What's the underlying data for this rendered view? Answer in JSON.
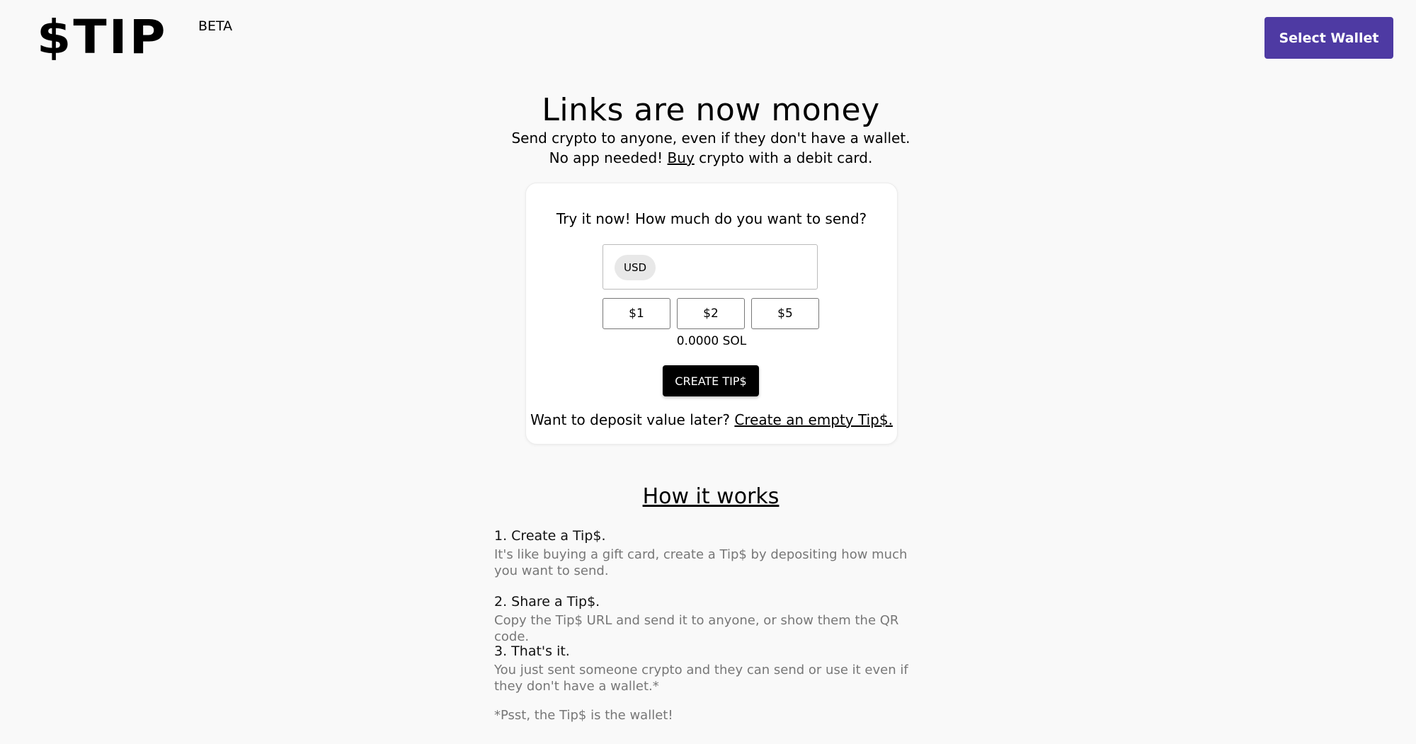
{
  "header": {
    "logo_text": "$TIP",
    "beta_label": "BETA",
    "wallet_button": "Select Wallet"
  },
  "hero": {
    "title": "Links are now money",
    "subtitle_line1": "Send crypto to anyone, even if they don't have a wallet.",
    "subtitle_line2_prefix": "No app needed! ",
    "subtitle_line2_link": "Buy",
    "subtitle_line2_suffix": " crypto with a debit card."
  },
  "card": {
    "prompt": "Try it now! How much do you want to send?",
    "currency": "USD",
    "amount_value": "",
    "presets": [
      "$1",
      "$2",
      "$5"
    ],
    "sol_amount": "0.0000 SOL",
    "create_button": "CREATE TIP$",
    "deposit_text": "Want to deposit value later? ",
    "deposit_link": "Create an empty Tip$."
  },
  "how_it_works": {
    "title": "How it works",
    "steps": [
      {
        "title": "1. Create a Tip$.",
        "description": "It's like buying a gift card, create a Tip$ by depositing how much you want to send."
      },
      {
        "title": "2. Share a Tip$.",
        "description": "Copy the Tip$ URL and send it to anyone, or show them the QR code."
      },
      {
        "title": "3. That's it.",
        "description": "You just sent someone crypto and they can send or use it even if they don't have a wallet.*"
      }
    ],
    "footnote": "*Psst, the Tip$ is the wallet!"
  },
  "colors": {
    "background": "#f9f9f9",
    "wallet_button": "#4e3aa3",
    "create_button": "#000000",
    "muted_text": "#777777"
  }
}
